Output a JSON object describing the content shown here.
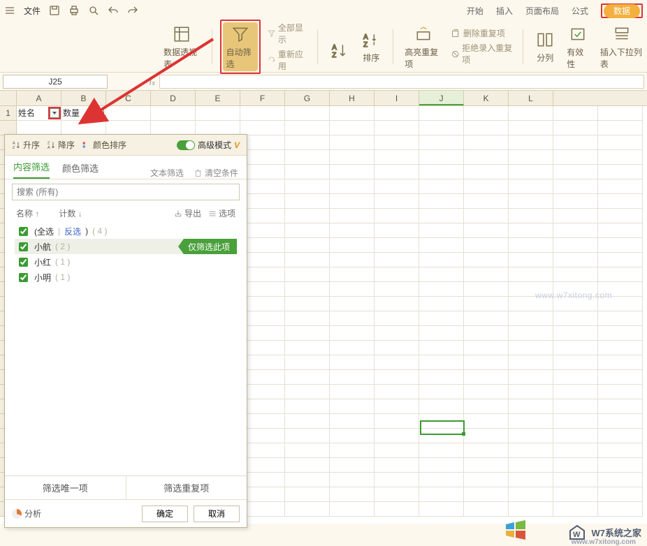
{
  "menubar": {
    "file": "文件",
    "tabs": {
      "start": "开始",
      "insert": "插入",
      "layout": "页面布局",
      "formula": "公式",
      "data": "数据"
    }
  },
  "ribbon": {
    "pivot": "数据透视表",
    "autofilter": "自动筛选",
    "showall": "全部显示",
    "reapply": "重新应用",
    "sort": "排序",
    "highlight": "高亮重复项",
    "deldup": "删除重复项",
    "rejectdup": "拒绝录入重复项",
    "split": "分列",
    "validity": "有效性",
    "dropdown": "插入下拉列表"
  },
  "cellref": "J25",
  "columns": [
    "A",
    "B",
    "C",
    "D",
    "E",
    "F",
    "G",
    "H",
    "I",
    "J",
    "K",
    "L"
  ],
  "headers": {
    "col_a": "姓名",
    "col_b": "数量"
  },
  "filter": {
    "sort_asc": "升序",
    "sort_desc": "降序",
    "color_sort": "颜色排序",
    "adv_mode": "高级模式",
    "tab_content": "内容筛选",
    "tab_color": "颜色筛选",
    "tab_text": "文本筛选",
    "clear": "清空条件",
    "search_ph": "搜索 (所有)",
    "col_name": "名称",
    "col_count": "计数",
    "export": "导出",
    "options": "选项",
    "all_lbl": "(全选",
    "inverse_lbl": "反选",
    "all_cnt": "( 4 )",
    "items": [
      {
        "name": "小航",
        "cnt": "( 2 )",
        "sel": true
      },
      {
        "name": "小红",
        "cnt": "( 1 )",
        "sel": false
      },
      {
        "name": "小明",
        "cnt": "( 1 )",
        "sel": false
      }
    ],
    "only_this": "仅筛选此项",
    "unique": "筛选唯一项",
    "dup": "筛选重复项",
    "analyze": "分析",
    "ok": "确定",
    "cancel": "取消"
  },
  "watermark": {
    "txt": "W7系统之家",
    "url": "www.w7xitong.com"
  }
}
